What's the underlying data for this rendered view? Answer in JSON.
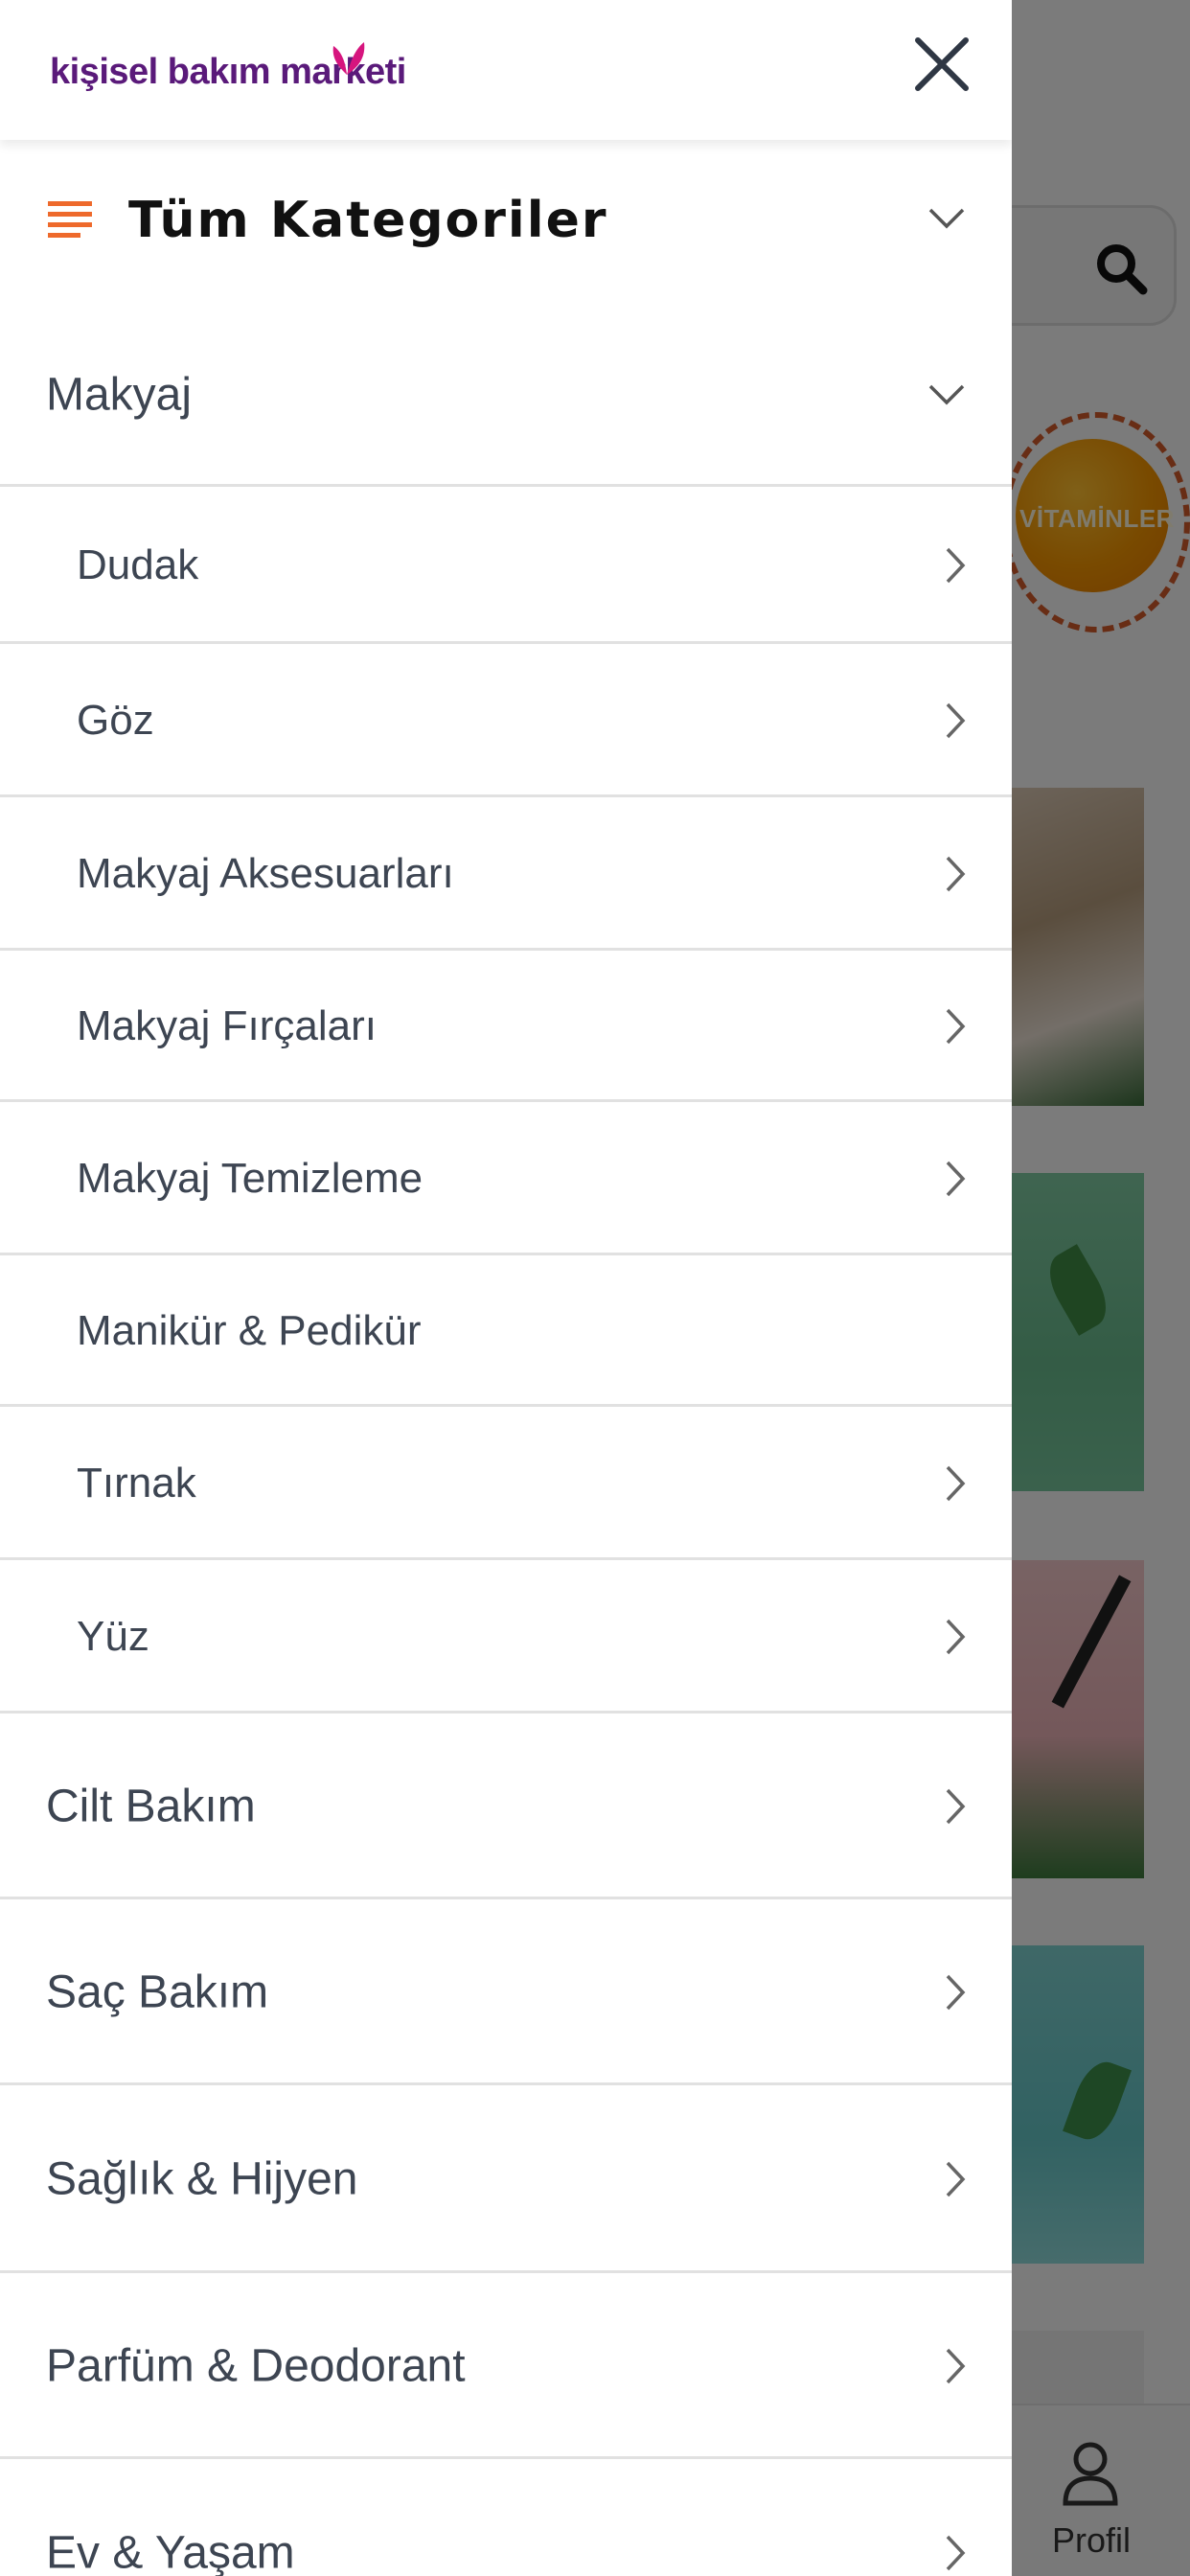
{
  "background": {
    "vitamin_badge": "VİTAMİNLER",
    "bottom_nav": {
      "profile_label": "Profil"
    }
  },
  "drawer": {
    "logo_text": "kişisel bakım marketi",
    "all_categories_label": "Tüm Kategoriler",
    "sections": [
      {
        "label": "Makyaj",
        "expanded": true,
        "children": [
          {
            "label": "Dudak",
            "has_children": true
          },
          {
            "label": "Göz",
            "has_children": true
          },
          {
            "label": "Makyaj Aksesuarları",
            "has_children": true
          },
          {
            "label": "Makyaj Fırçaları",
            "has_children": true
          },
          {
            "label": "Makyaj Temizleme",
            "has_children": true
          },
          {
            "label": "Manikür & Pedikür",
            "has_children": false
          },
          {
            "label": "Tırnak",
            "has_children": true
          },
          {
            "label": "Yüz",
            "has_children": true
          }
        ]
      },
      {
        "label": "Cilt Bakım",
        "expanded": false
      },
      {
        "label": "Saç Bakım",
        "expanded": false
      },
      {
        "label": "Sağlık & Hijyen",
        "expanded": false
      },
      {
        "label": "Parfüm & Deodorant",
        "expanded": false
      },
      {
        "label": "Ev & Yaşam",
        "expanded": false
      }
    ]
  },
  "colors": {
    "accent_orange": "#ee6a2c",
    "logo_purple": "#5a1a7a",
    "logo_pink": "#d6157e",
    "text": "#3d4552",
    "divider": "#e1e1e1"
  },
  "icons": {
    "close": "close-icon",
    "menu": "list-icon",
    "chevron_down": "chevron-down-icon",
    "chevron_right": "chevron-right-icon",
    "search": "search-icon",
    "profile": "user-icon"
  }
}
